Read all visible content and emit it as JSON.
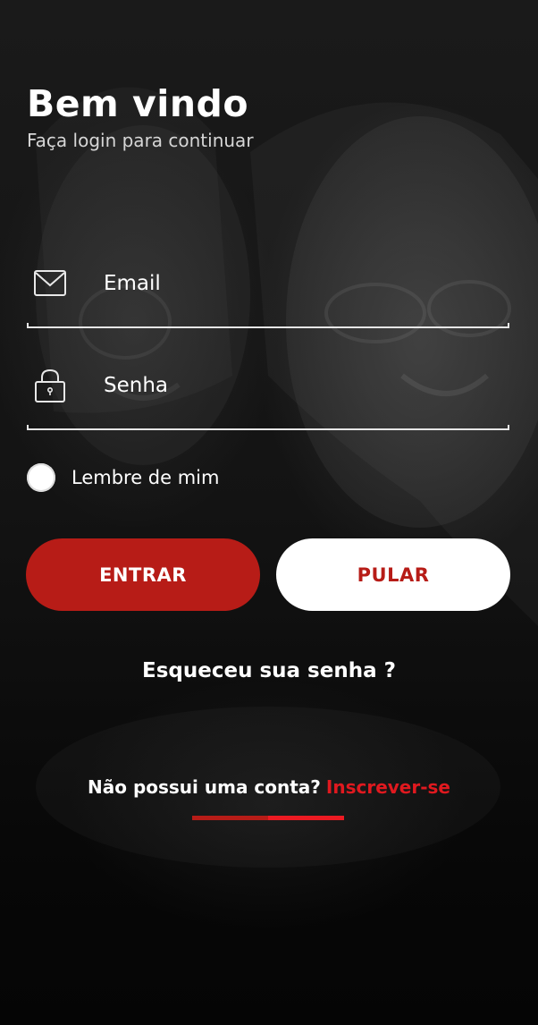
{
  "header": {
    "title": "Bem vindo",
    "subtitle": "Faça login para continuar"
  },
  "form": {
    "email": {
      "placeholder": "Email",
      "value": "",
      "icon": "mail-icon"
    },
    "password": {
      "placeholder": "Senha",
      "value": "",
      "icon": "lock-icon"
    },
    "remember_me": {
      "label": "Lembre de mim",
      "checked": false
    }
  },
  "actions": {
    "enter_label": "ENTRAR",
    "skip_label": "PULAR",
    "forgot_label": "Esqueceu sua senha ?"
  },
  "signup": {
    "question": "Não possui uma conta?",
    "link_label": "Inscrever-se"
  },
  "colors": {
    "accent": "#b71c17",
    "link": "#e0191f",
    "background": "#111111",
    "text": "#ffffff"
  }
}
